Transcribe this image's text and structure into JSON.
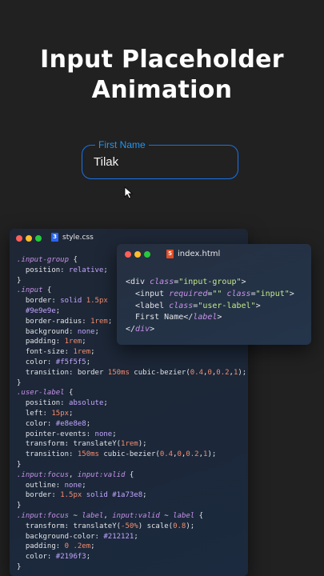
{
  "title": {
    "line1": "Input Placeholder",
    "line2": "Animation"
  },
  "demo": {
    "label": "First Name",
    "value": "Tilak"
  },
  "css_editor": {
    "filename": "style.css",
    "lines": [
      [
        {
          "t": ".input-group",
          "c": "sel"
        },
        {
          "t": " {"
        }
      ],
      [
        {
          "t": "  position: "
        },
        {
          "t": "relative",
          "c": "val"
        },
        {
          "t": ";"
        }
      ],
      [
        {
          "t": "}"
        }
      ],
      [
        {
          "t": ".input",
          "c": "sel"
        },
        {
          "t": " {"
        }
      ],
      [
        {
          "t": "  border: "
        },
        {
          "t": "solid",
          "c": "val"
        },
        {
          "t": " "
        },
        {
          "t": "1.5px",
          "c": "num"
        }
      ],
      [
        {
          "t": "  "
        },
        {
          "t": "#9e9e9e",
          "c": "val"
        },
        {
          "t": ";"
        }
      ],
      [
        {
          "t": "  border-radius: "
        },
        {
          "t": "1rem",
          "c": "num"
        },
        {
          "t": ";"
        }
      ],
      [
        {
          "t": "  background: "
        },
        {
          "t": "none",
          "c": "val"
        },
        {
          "t": ";"
        }
      ],
      [
        {
          "t": "  padding: "
        },
        {
          "t": "1rem",
          "c": "num"
        },
        {
          "t": ";"
        }
      ],
      [
        {
          "t": "  font-size: "
        },
        {
          "t": "1rem",
          "c": "num"
        },
        {
          "t": ";"
        }
      ],
      [
        {
          "t": "  color: "
        },
        {
          "t": "#f5f5f5",
          "c": "val"
        },
        {
          "t": ";"
        }
      ],
      [
        {
          "t": "  transition: border "
        },
        {
          "t": "150ms",
          "c": "num"
        },
        {
          "t": " cubic-bezier("
        },
        {
          "t": "0.4",
          "c": "num"
        },
        {
          "t": ","
        },
        {
          "t": "0",
          "c": "num"
        },
        {
          "t": ","
        },
        {
          "t": "0.2",
          "c": "num"
        },
        {
          "t": ","
        },
        {
          "t": "1",
          "c": "num"
        },
        {
          "t": ");"
        }
      ],
      [
        {
          "t": "}"
        }
      ],
      [
        {
          "t": ".user-label",
          "c": "sel"
        },
        {
          "t": " {"
        }
      ],
      [
        {
          "t": "  position: "
        },
        {
          "t": "absolute",
          "c": "val"
        },
        {
          "t": ";"
        }
      ],
      [
        {
          "t": "  left: "
        },
        {
          "t": "15px",
          "c": "num"
        },
        {
          "t": ";"
        }
      ],
      [
        {
          "t": "  color: "
        },
        {
          "t": "#e8e8e8",
          "c": "val"
        },
        {
          "t": ";"
        }
      ],
      [
        {
          "t": "  pointer-events: "
        },
        {
          "t": "none",
          "c": "val"
        },
        {
          "t": ";"
        }
      ],
      [
        {
          "t": "  transform: translateY("
        },
        {
          "t": "1rem",
          "c": "num"
        },
        {
          "t": ");"
        }
      ],
      [
        {
          "t": "  transition: "
        },
        {
          "t": "150ms",
          "c": "num"
        },
        {
          "t": " cubic-bezier("
        },
        {
          "t": "0.4",
          "c": "num"
        },
        {
          "t": ","
        },
        {
          "t": "0",
          "c": "num"
        },
        {
          "t": ","
        },
        {
          "t": "0.2",
          "c": "num"
        },
        {
          "t": ","
        },
        {
          "t": "1",
          "c": "num"
        },
        {
          "t": ");"
        }
      ],
      [
        {
          "t": "}"
        }
      ],
      [
        {
          "t": ".input:focus",
          "c": "sel"
        },
        {
          "t": ", "
        },
        {
          "t": "input:valid",
          "c": "sel"
        },
        {
          "t": " {"
        }
      ],
      [
        {
          "t": "  outline: "
        },
        {
          "t": "none",
          "c": "val"
        },
        {
          "t": ";"
        }
      ],
      [
        {
          "t": "  border: "
        },
        {
          "t": "1.5px",
          "c": "num"
        },
        {
          "t": " "
        },
        {
          "t": "solid",
          "c": "val"
        },
        {
          "t": " "
        },
        {
          "t": "#1a73e8",
          "c": "val"
        },
        {
          "t": ";"
        }
      ],
      [
        {
          "t": "}"
        }
      ],
      [
        {
          "t": ".input:focus",
          "c": "sel"
        },
        {
          "t": " ~ "
        },
        {
          "t": "label",
          "c": "sel"
        },
        {
          "t": ", "
        },
        {
          "t": "input:valid",
          "c": "sel"
        },
        {
          "t": " ~ "
        },
        {
          "t": "label",
          "c": "sel"
        },
        {
          "t": " {"
        }
      ],
      [
        {
          "t": "  transform: translateY("
        },
        {
          "t": "-50%",
          "c": "num"
        },
        {
          "t": ") scale("
        },
        {
          "t": "0.8",
          "c": "num"
        },
        {
          "t": ");"
        }
      ],
      [
        {
          "t": "  background-color: "
        },
        {
          "t": "#212121",
          "c": "val"
        },
        {
          "t": ";"
        }
      ],
      [
        {
          "t": "  padding: "
        },
        {
          "t": "0",
          "c": "num"
        },
        {
          "t": " "
        },
        {
          "t": ".2em",
          "c": "num"
        },
        {
          "t": ";"
        }
      ],
      [
        {
          "t": "  color: "
        },
        {
          "t": "#2196f3",
          "c": "val"
        },
        {
          "t": ";"
        }
      ],
      [
        {
          "t": "}"
        }
      ]
    ]
  },
  "html_editor": {
    "filename": "index.html",
    "lines": [
      [
        {
          "t": "<div "
        },
        {
          "t": "class",
          "c": "attr"
        },
        {
          "t": "="
        },
        {
          "t": "\"input-group\"",
          "c": "str"
        },
        {
          "t": ">"
        }
      ],
      [
        {
          "t": "  <input "
        },
        {
          "t": "required",
          "c": "attr"
        },
        {
          "t": "="
        },
        {
          "t": "\"\"",
          "c": "str"
        },
        {
          "t": " "
        },
        {
          "t": "class",
          "c": "attr"
        },
        {
          "t": "="
        },
        {
          "t": "\"input\"",
          "c": "str"
        },
        {
          "t": ">"
        }
      ],
      [
        {
          "t": "  <label "
        },
        {
          "t": "class",
          "c": "attr"
        },
        {
          "t": "="
        },
        {
          "t": "\"user-label\"",
          "c": "str"
        },
        {
          "t": ">"
        }
      ],
      [
        {
          "t": "  First Name</"
        },
        {
          "t": "label",
          "c": "attr"
        },
        {
          "t": ">"
        }
      ],
      [
        {
          "t": "</"
        },
        {
          "t": "div",
          "c": "attr"
        },
        {
          "t": ">"
        }
      ]
    ]
  },
  "colors": {
    "background": "#212121",
    "focus_border": "#1a73e8",
    "label": "#2196f3",
    "dot_red": "#ff5f56",
    "dot_yellow": "#ffbd2e",
    "dot_green": "#27c93f",
    "css_icon": "#2965f1",
    "html_icon": "#e44d26"
  },
  "icons": {
    "cursor": "mouse-pointer-icon",
    "css_file": "css3-icon",
    "html_file": "html5-icon"
  }
}
